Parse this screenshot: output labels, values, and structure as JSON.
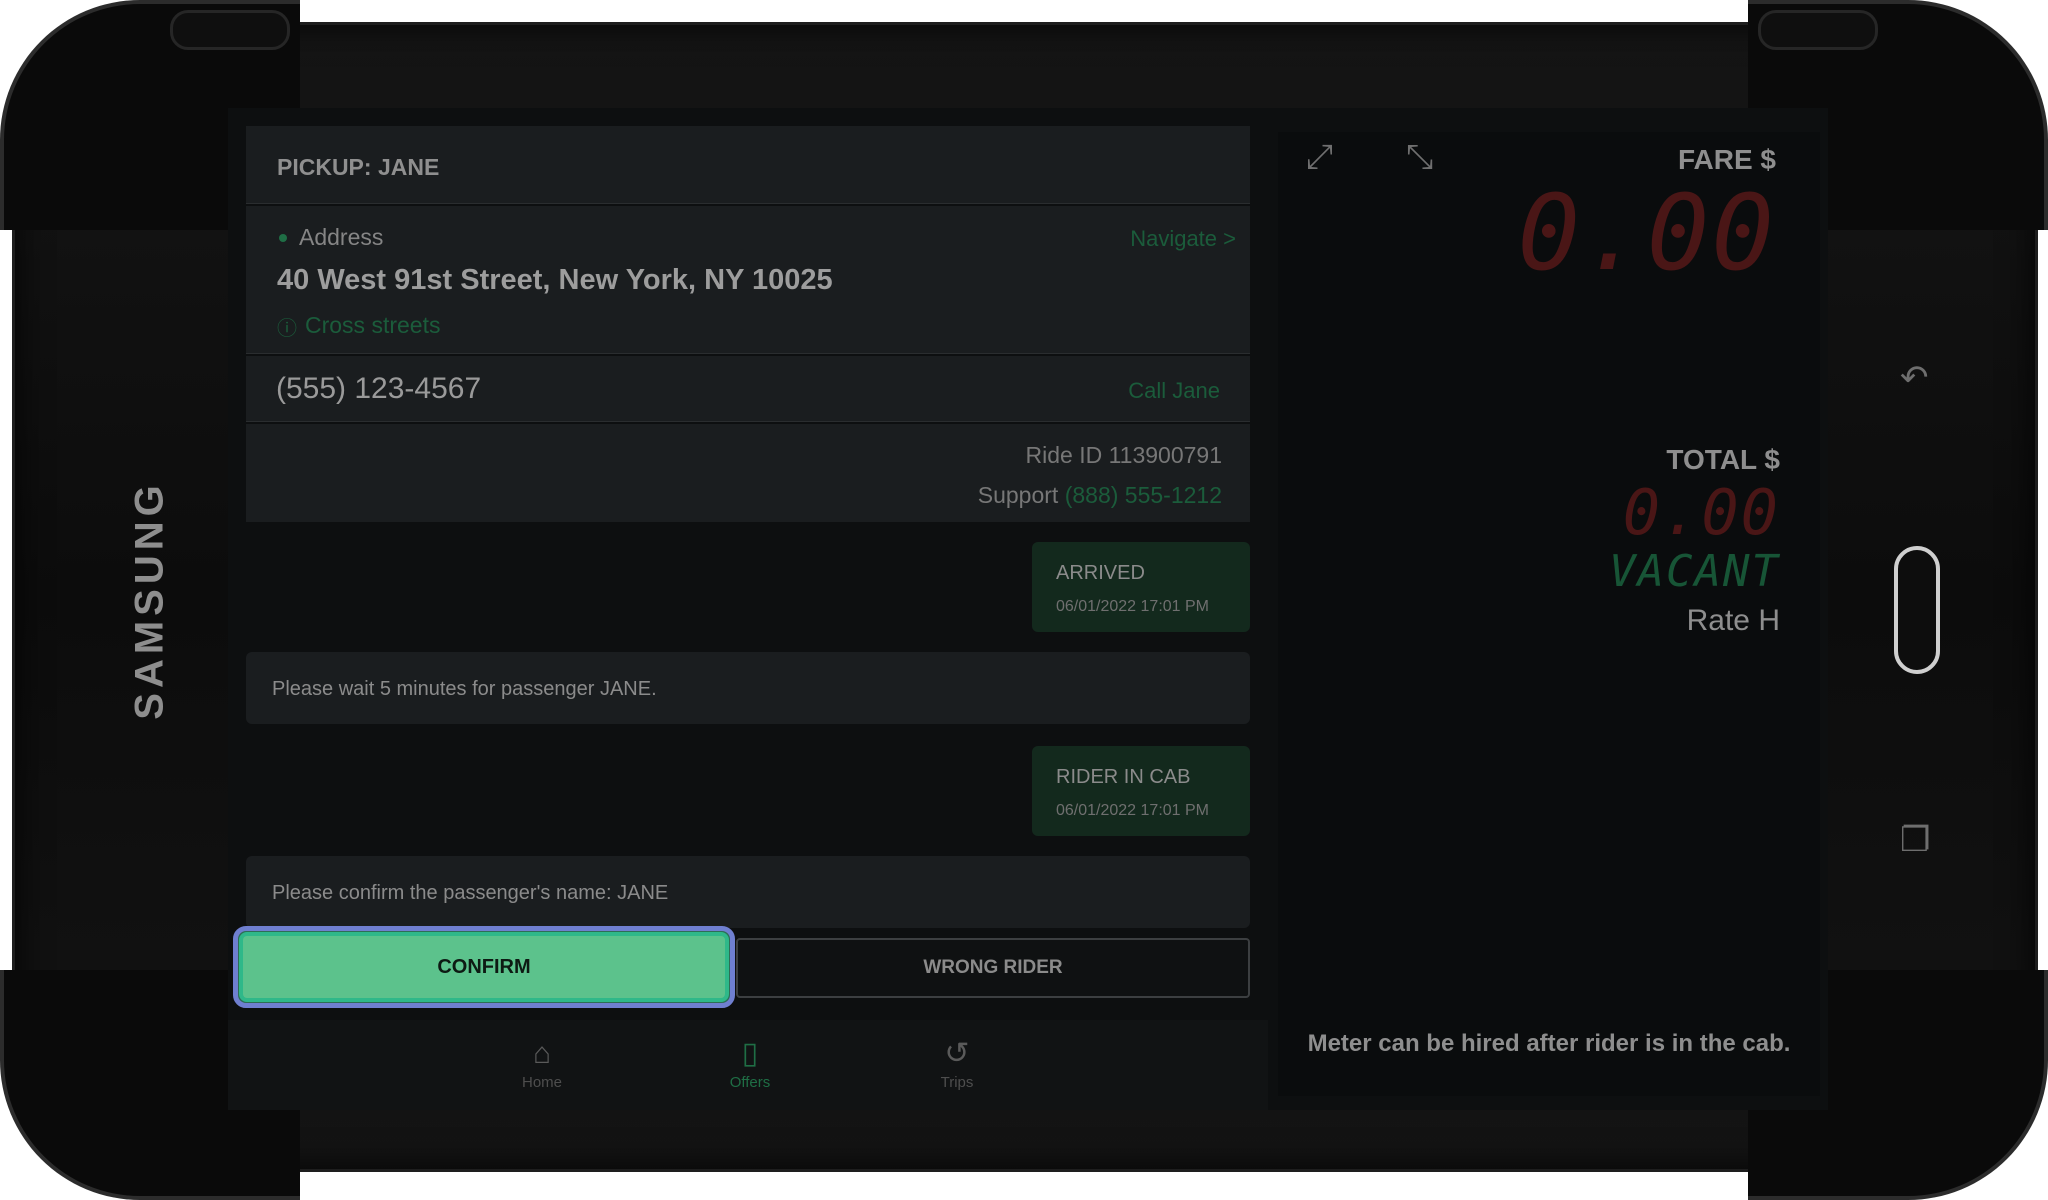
{
  "device": {
    "brand": "SAMSUNG"
  },
  "pickup": {
    "title": "PICKUP: JANE",
    "address_label": "Address",
    "navigate_label": "Navigate >",
    "address": "40 West 91st Street, New York, NY 10025",
    "cross_streets_label": "Cross streets",
    "phone": "(555) 123-4567",
    "call_label": "Call Jane",
    "ride_id": "Ride ID 113900791",
    "support_label": "Support",
    "support_phone": "(888) 555-1212"
  },
  "timeline": [
    {
      "type": "status",
      "label": "ARRIVED",
      "time": "06/01/2022 17:01 PM"
    },
    {
      "type": "message",
      "text": "Please wait 5 minutes for passenger JANE."
    },
    {
      "type": "status",
      "label": "RIDER IN CAB",
      "time": "06/01/2022 17:01 PM"
    },
    {
      "type": "message",
      "text": "Please confirm the passenger's name: JANE"
    }
  ],
  "actions": {
    "confirm_label": "CONFIRM",
    "wrong_rider_label": "WRONG RIDER"
  },
  "nav": [
    {
      "label": "Home",
      "icon": "home-icon",
      "active": false
    },
    {
      "label": "Offers",
      "icon": "phone-icon",
      "active": true
    },
    {
      "label": "Trips",
      "icon": "history-icon",
      "active": false
    }
  ],
  "meter": {
    "fare_label": "FARE $",
    "fare_value": "0.00",
    "total_label": "TOTAL $",
    "total_value": "0.00",
    "status": "VACANT",
    "rate": "Rate H",
    "note": "Meter can be hired after rider is in the cab."
  },
  "colors": {
    "accent_green": "#5cc28c",
    "link_green": "#1b5c3b",
    "focus_ring": "#6f7fd0",
    "meter_red": "#4a1616",
    "background": "#0d0f10"
  }
}
